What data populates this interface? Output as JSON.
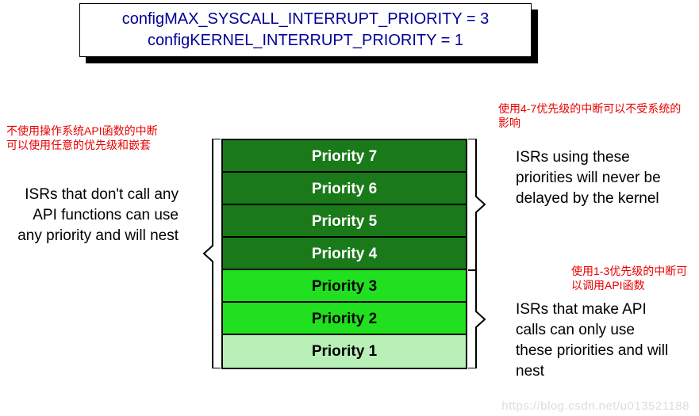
{
  "config": {
    "line1": "configMAX_SYSCALL_INTERRUPT_PRIORITY = 3",
    "line2": "configKERNEL_INTERRUPT_PRIORITY = 1"
  },
  "priorities": {
    "p7": "Priority 7",
    "p6": "Priority 6",
    "p5": "Priority 5",
    "p4": "Priority 4",
    "p3": "Priority 3",
    "p2": "Priority 2",
    "p1": "Priority 1"
  },
  "labels": {
    "left": "ISRs that don't call any API functions can use any priority and will nest",
    "right_top": "ISRs using these priorities will never be delayed by the kernel",
    "right_bottom": "ISRs that make API calls can only use these priorities and will nest"
  },
  "annotations": {
    "left_red": "不使用操作系统API函数的中断可以使用任意的优先级和嵌套",
    "right_red_top": "使用4-7优先级的中断可以不受系统的影响",
    "right_red_bottom": "使用1-3优先级的中断可以调用API函数"
  },
  "watermark": "https://blog.csdn.net/u013521188",
  "chart_data": {
    "type": "table",
    "title": "FreeRTOS interrupt priority configuration",
    "config_values": {
      "configMAX_SYSCALL_INTERRUPT_PRIORITY": 3,
      "configKERNEL_INTERRUPT_PRIORITY": 1
    },
    "rows": [
      {
        "priority": 7,
        "group": "above_syscall",
        "color": "dark_green"
      },
      {
        "priority": 6,
        "group": "above_syscall",
        "color": "dark_green"
      },
      {
        "priority": 5,
        "group": "above_syscall",
        "color": "dark_green"
      },
      {
        "priority": 4,
        "group": "above_syscall",
        "color": "dark_green"
      },
      {
        "priority": 3,
        "group": "api_safe",
        "color": "bright_green"
      },
      {
        "priority": 2,
        "group": "api_safe",
        "color": "bright_green"
      },
      {
        "priority": 1,
        "group": "api_safe",
        "color": "light_green"
      }
    ],
    "groups": {
      "above_syscall": {
        "range": [
          4,
          7
        ],
        "meaning_en": "ISRs using these priorities will never be delayed by the kernel",
        "meaning_zh": "使用4-7优先级的中断可以不受系统的影响"
      },
      "api_safe": {
        "range": [
          1,
          3
        ],
        "meaning_en": "ISRs that make API calls can only use these priorities and will nest",
        "meaning_zh": "使用1-3优先级的中断可以调用API函数"
      },
      "all": {
        "range": [
          1,
          7
        ],
        "meaning_en": "ISRs that don't call any API functions can use any priority and will nest",
        "meaning_zh": "不使用操作系统API函数的中断可以使用任意的优先级和嵌套"
      }
    }
  }
}
